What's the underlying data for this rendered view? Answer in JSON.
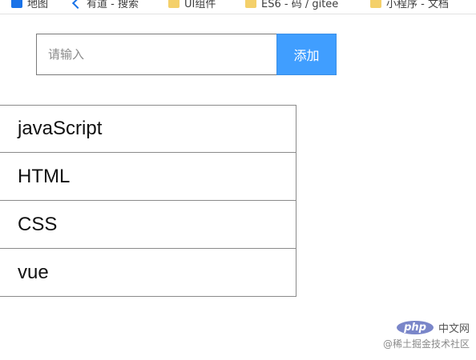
{
  "bookmarks": [
    {
      "label": "地图",
      "icon": "map-icon"
    },
    {
      "label": "有道 - 搜索",
      "icon": "back-arrow-icon"
    },
    {
      "label": "UI组件",
      "icon": "folder-icon"
    },
    {
      "label": "ES6 - 码 / gitee",
      "icon": "folder-icon"
    },
    {
      "label": "小程序 - 文档",
      "icon": "folder-icon"
    }
  ],
  "form": {
    "placeholder": "请输入",
    "value": "",
    "add_label": "添加"
  },
  "list": {
    "items": [
      "javaScript",
      "HTML",
      "CSS",
      "vue"
    ]
  },
  "watermark": {
    "logo": "php",
    "site": "中文网",
    "credit": "@稀土掘金技术社区"
  },
  "colors": {
    "accent": "#409eff",
    "border": "#8a8a8a"
  }
}
